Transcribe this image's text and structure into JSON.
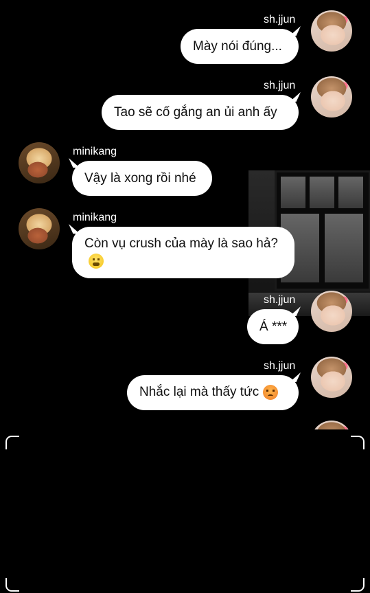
{
  "messages": [
    {
      "sender": "sh.jjun",
      "side": "right",
      "text": "Mày nói đúng..."
    },
    {
      "sender": "sh.jjun",
      "side": "right",
      "text": "Tao sẽ cố gắng an ủi anh ấy"
    },
    {
      "sender": "minikang",
      "side": "left",
      "text": "Vậy là xong rồi nhé"
    },
    {
      "sender": "minikang",
      "side": "left",
      "text": "Còn vụ crush của mày là sao hả?",
      "emoji": "steaming-face-emoji"
    },
    {
      "sender": "sh.jjun",
      "side": "right",
      "text": "Á ***"
    },
    {
      "sender": "sh.jjun",
      "side": "right",
      "text": "Nhắc lại mà thấy tức",
      "emoji": "angry-face-emoji"
    }
  ],
  "colors": {
    "background": "#000000",
    "bubble": "#ffffff",
    "name_text": "#ffffff",
    "message_text": "#111111"
  }
}
